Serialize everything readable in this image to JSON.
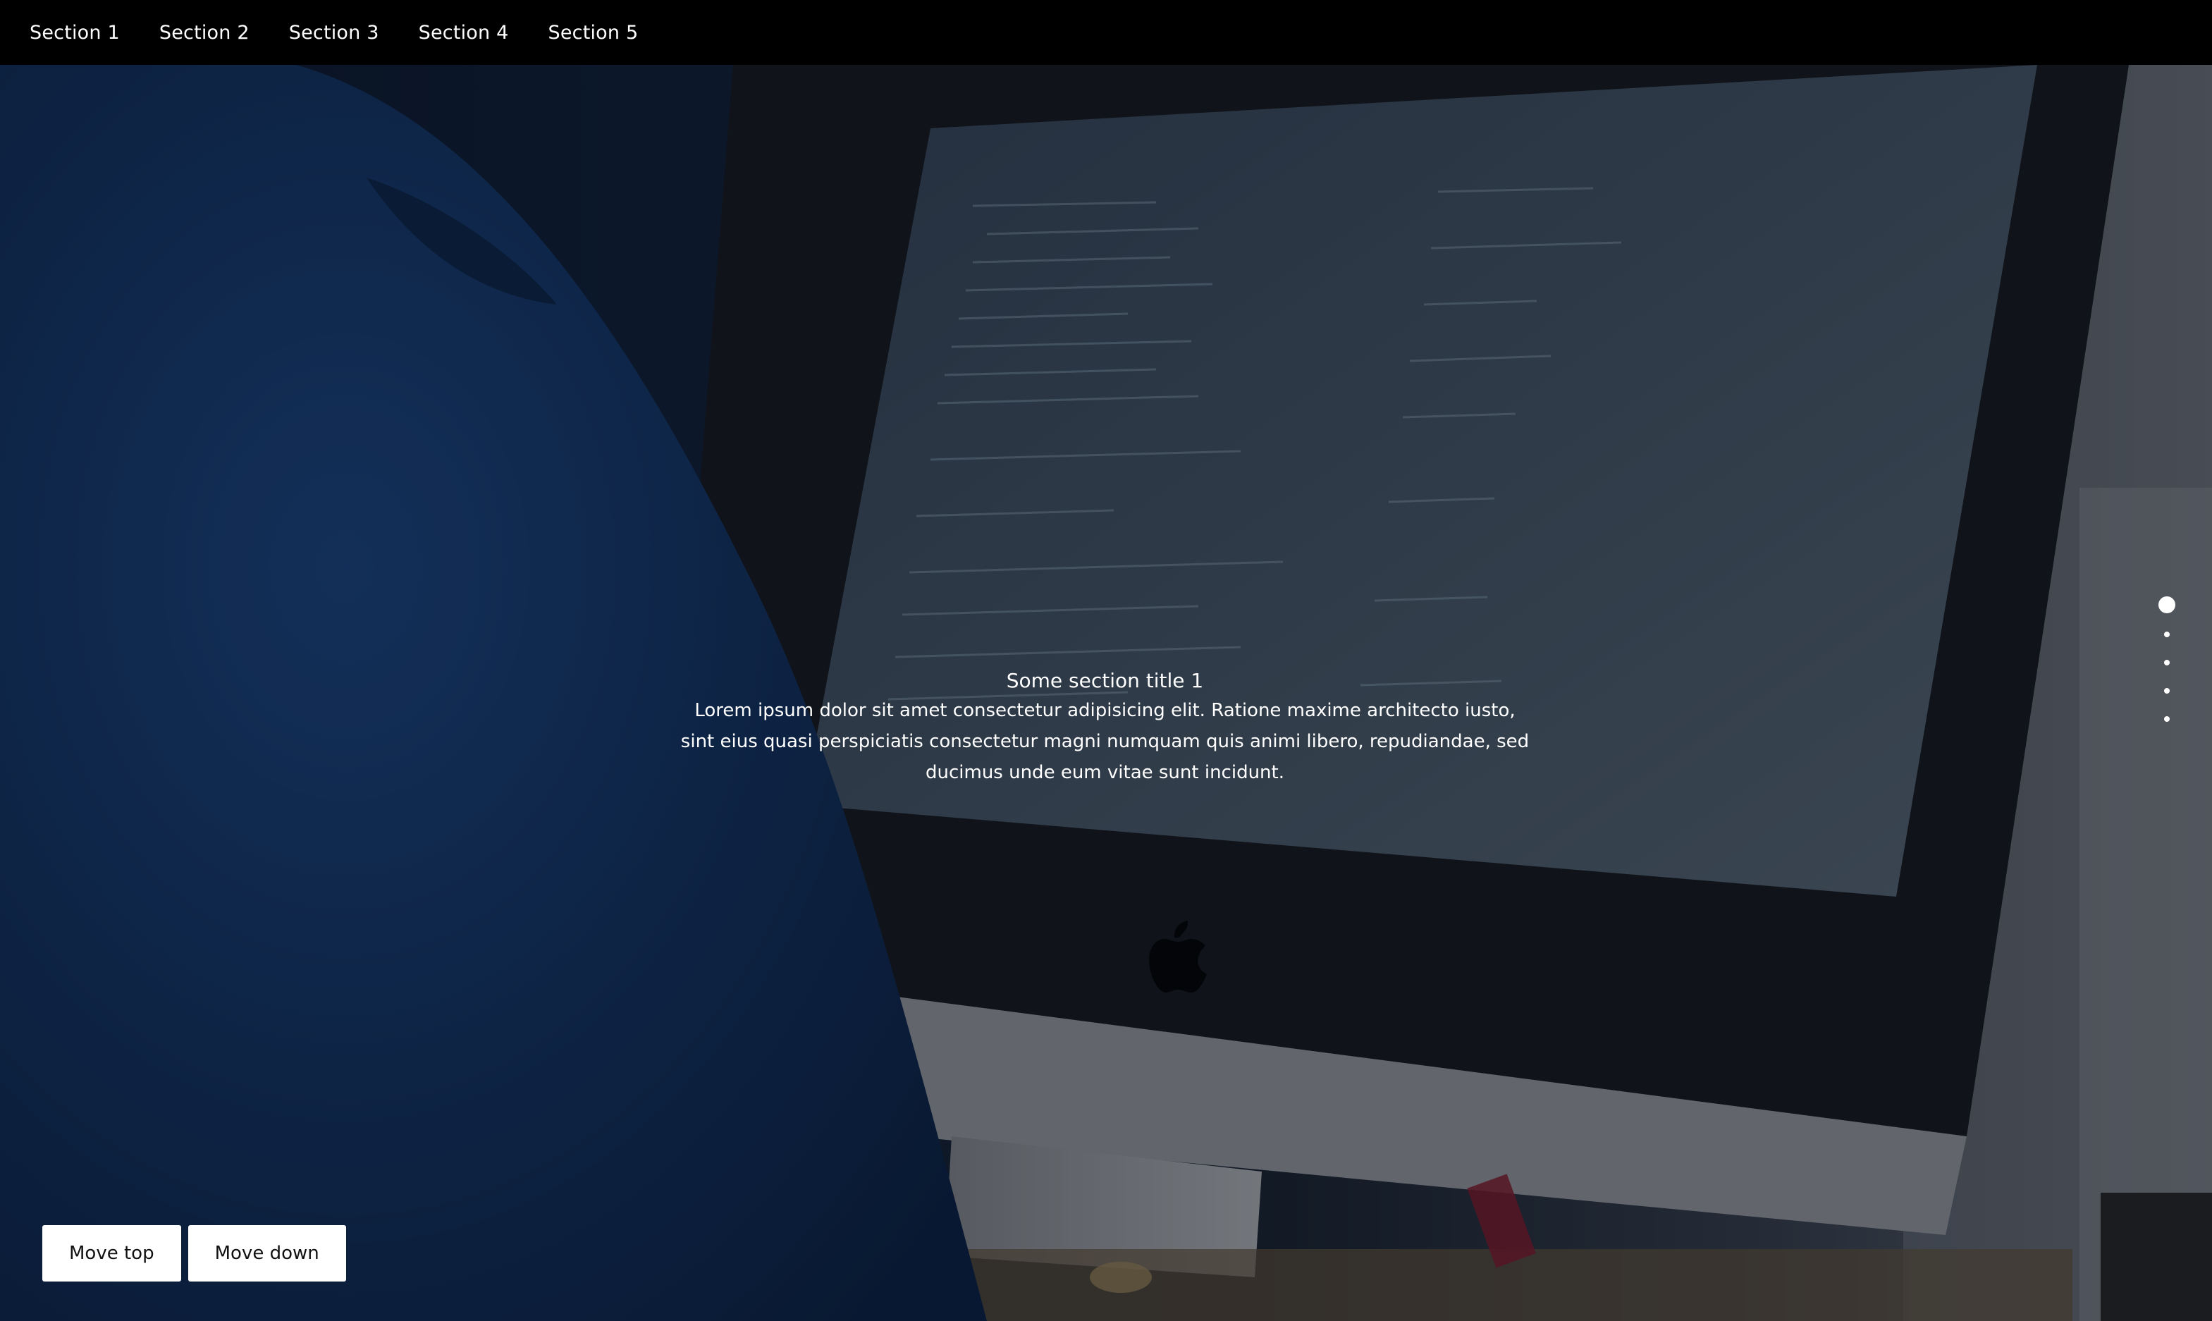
{
  "nav": {
    "items": [
      {
        "label": "Section 1"
      },
      {
        "label": "Section 2"
      },
      {
        "label": "Section 3"
      },
      {
        "label": "Section 4"
      },
      {
        "label": "Section 5"
      }
    ]
  },
  "section": {
    "title": "Some section title 1",
    "body": "Lorem ipsum dolor sit amet consectetur adipisicing elit. Ratione maxime architecto iusto, sint eius quasi perspiciatis consectetur magni numquam quis animi libero, repudiandae, sed ducimus unde eum vitae sunt incidunt."
  },
  "dot_nav": {
    "count": 5,
    "active_index": 0
  },
  "buttons": {
    "move_top": "Move top",
    "move_down": "Move down"
  },
  "colors": {
    "nav_background": "#000000",
    "text": "#ffffff",
    "button_background": "#ffffff"
  },
  "background": {
    "icon": "apple-logo-icon"
  }
}
